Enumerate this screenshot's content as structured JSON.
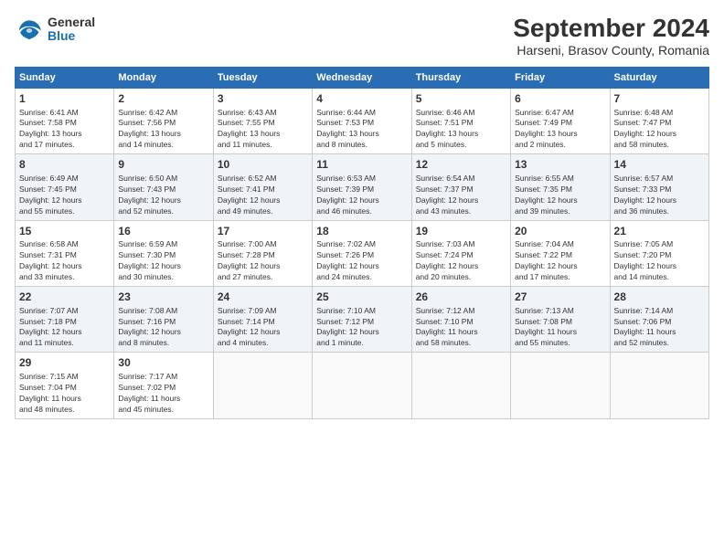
{
  "logo": {
    "general": "General",
    "blue": "Blue"
  },
  "title": "September 2024",
  "subtitle": "Harseni, Brasov County, Romania",
  "days_of_week": [
    "Sunday",
    "Monday",
    "Tuesday",
    "Wednesday",
    "Thursday",
    "Friday",
    "Saturday"
  ],
  "weeks": [
    [
      {
        "num": "1",
        "lines": [
          "Sunrise: 6:41 AM",
          "Sunset: 7:58 PM",
          "Daylight: 13 hours",
          "and 17 minutes."
        ]
      },
      {
        "num": "2",
        "lines": [
          "Sunrise: 6:42 AM",
          "Sunset: 7:56 PM",
          "Daylight: 13 hours",
          "and 14 minutes."
        ]
      },
      {
        "num": "3",
        "lines": [
          "Sunrise: 6:43 AM",
          "Sunset: 7:55 PM",
          "Daylight: 13 hours",
          "and 11 minutes."
        ]
      },
      {
        "num": "4",
        "lines": [
          "Sunrise: 6:44 AM",
          "Sunset: 7:53 PM",
          "Daylight: 13 hours",
          "and 8 minutes."
        ]
      },
      {
        "num": "5",
        "lines": [
          "Sunrise: 6:46 AM",
          "Sunset: 7:51 PM",
          "Daylight: 13 hours",
          "and 5 minutes."
        ]
      },
      {
        "num": "6",
        "lines": [
          "Sunrise: 6:47 AM",
          "Sunset: 7:49 PM",
          "Daylight: 13 hours",
          "and 2 minutes."
        ]
      },
      {
        "num": "7",
        "lines": [
          "Sunrise: 6:48 AM",
          "Sunset: 7:47 PM",
          "Daylight: 12 hours",
          "and 58 minutes."
        ]
      }
    ],
    [
      {
        "num": "8",
        "lines": [
          "Sunrise: 6:49 AM",
          "Sunset: 7:45 PM",
          "Daylight: 12 hours",
          "and 55 minutes."
        ]
      },
      {
        "num": "9",
        "lines": [
          "Sunrise: 6:50 AM",
          "Sunset: 7:43 PM",
          "Daylight: 12 hours",
          "and 52 minutes."
        ]
      },
      {
        "num": "10",
        "lines": [
          "Sunrise: 6:52 AM",
          "Sunset: 7:41 PM",
          "Daylight: 12 hours",
          "and 49 minutes."
        ]
      },
      {
        "num": "11",
        "lines": [
          "Sunrise: 6:53 AM",
          "Sunset: 7:39 PM",
          "Daylight: 12 hours",
          "and 46 minutes."
        ]
      },
      {
        "num": "12",
        "lines": [
          "Sunrise: 6:54 AM",
          "Sunset: 7:37 PM",
          "Daylight: 12 hours",
          "and 43 minutes."
        ]
      },
      {
        "num": "13",
        "lines": [
          "Sunrise: 6:55 AM",
          "Sunset: 7:35 PM",
          "Daylight: 12 hours",
          "and 39 minutes."
        ]
      },
      {
        "num": "14",
        "lines": [
          "Sunrise: 6:57 AM",
          "Sunset: 7:33 PM",
          "Daylight: 12 hours",
          "and 36 minutes."
        ]
      }
    ],
    [
      {
        "num": "15",
        "lines": [
          "Sunrise: 6:58 AM",
          "Sunset: 7:31 PM",
          "Daylight: 12 hours",
          "and 33 minutes."
        ]
      },
      {
        "num": "16",
        "lines": [
          "Sunrise: 6:59 AM",
          "Sunset: 7:30 PM",
          "Daylight: 12 hours",
          "and 30 minutes."
        ]
      },
      {
        "num": "17",
        "lines": [
          "Sunrise: 7:00 AM",
          "Sunset: 7:28 PM",
          "Daylight: 12 hours",
          "and 27 minutes."
        ]
      },
      {
        "num": "18",
        "lines": [
          "Sunrise: 7:02 AM",
          "Sunset: 7:26 PM",
          "Daylight: 12 hours",
          "and 24 minutes."
        ]
      },
      {
        "num": "19",
        "lines": [
          "Sunrise: 7:03 AM",
          "Sunset: 7:24 PM",
          "Daylight: 12 hours",
          "and 20 minutes."
        ]
      },
      {
        "num": "20",
        "lines": [
          "Sunrise: 7:04 AM",
          "Sunset: 7:22 PM",
          "Daylight: 12 hours",
          "and 17 minutes."
        ]
      },
      {
        "num": "21",
        "lines": [
          "Sunrise: 7:05 AM",
          "Sunset: 7:20 PM",
          "Daylight: 12 hours",
          "and 14 minutes."
        ]
      }
    ],
    [
      {
        "num": "22",
        "lines": [
          "Sunrise: 7:07 AM",
          "Sunset: 7:18 PM",
          "Daylight: 12 hours",
          "and 11 minutes."
        ]
      },
      {
        "num": "23",
        "lines": [
          "Sunrise: 7:08 AM",
          "Sunset: 7:16 PM",
          "Daylight: 12 hours",
          "and 8 minutes."
        ]
      },
      {
        "num": "24",
        "lines": [
          "Sunrise: 7:09 AM",
          "Sunset: 7:14 PM",
          "Daylight: 12 hours",
          "and 4 minutes."
        ]
      },
      {
        "num": "25",
        "lines": [
          "Sunrise: 7:10 AM",
          "Sunset: 7:12 PM",
          "Daylight: 12 hours",
          "and 1 minute."
        ]
      },
      {
        "num": "26",
        "lines": [
          "Sunrise: 7:12 AM",
          "Sunset: 7:10 PM",
          "Daylight: 11 hours",
          "and 58 minutes."
        ]
      },
      {
        "num": "27",
        "lines": [
          "Sunrise: 7:13 AM",
          "Sunset: 7:08 PM",
          "Daylight: 11 hours",
          "and 55 minutes."
        ]
      },
      {
        "num": "28",
        "lines": [
          "Sunrise: 7:14 AM",
          "Sunset: 7:06 PM",
          "Daylight: 11 hours",
          "and 52 minutes."
        ]
      }
    ],
    [
      {
        "num": "29",
        "lines": [
          "Sunrise: 7:15 AM",
          "Sunset: 7:04 PM",
          "Daylight: 11 hours",
          "and 48 minutes."
        ]
      },
      {
        "num": "30",
        "lines": [
          "Sunrise: 7:17 AM",
          "Sunset: 7:02 PM",
          "Daylight: 11 hours",
          "and 45 minutes."
        ]
      },
      null,
      null,
      null,
      null,
      null
    ]
  ]
}
